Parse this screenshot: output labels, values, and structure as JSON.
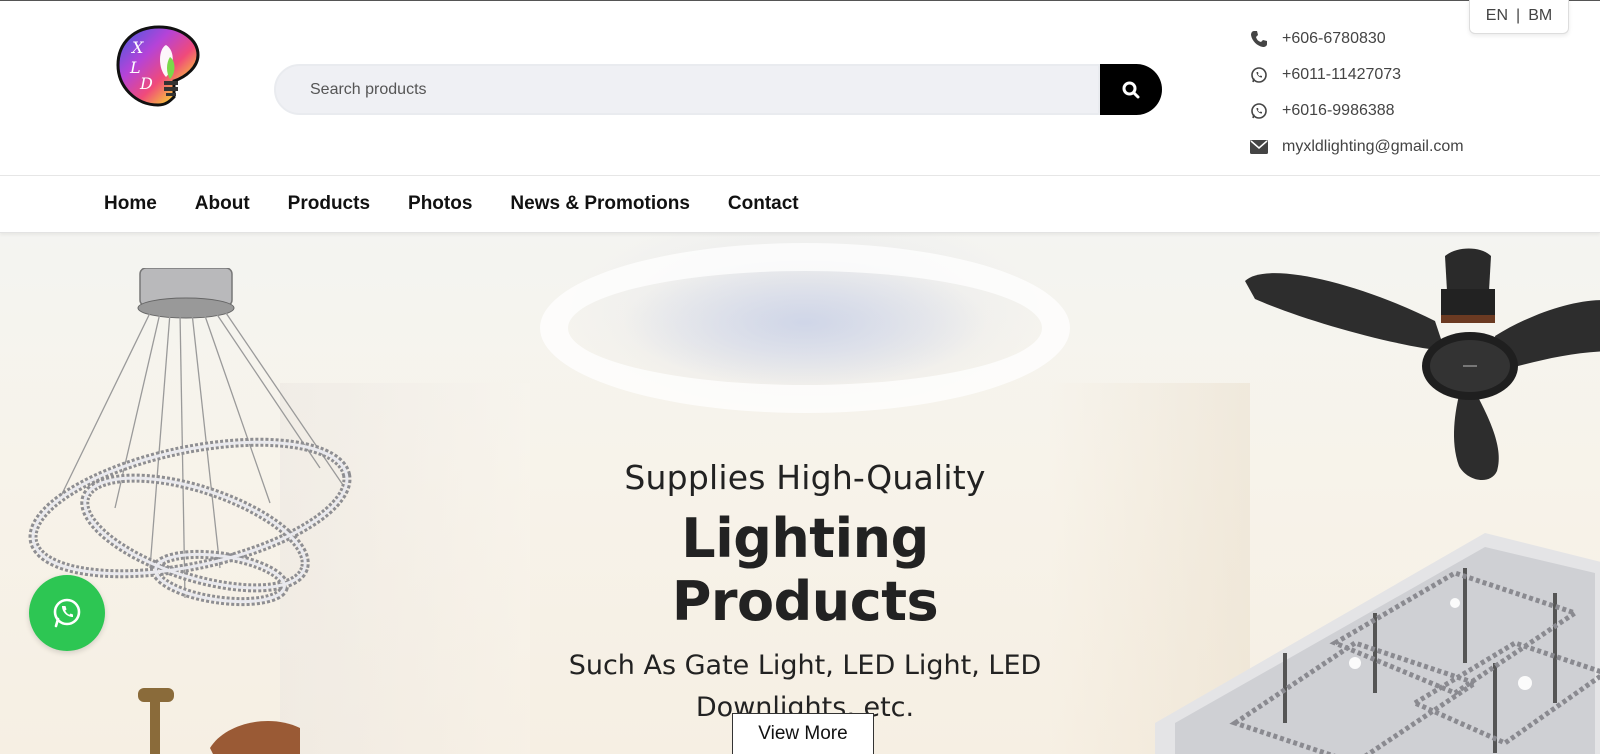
{
  "header": {
    "search": {
      "placeholder": "Search products"
    },
    "contacts": [
      {
        "icon": "phone-icon",
        "text": "+606-6780830"
      },
      {
        "icon": "whatsapp-icon",
        "text": "+6011-11427073"
      },
      {
        "icon": "whatsapp-icon",
        "text": "+6016-9986388"
      },
      {
        "icon": "envelope-icon",
        "text": "myxldlighting@gmail.com"
      }
    ],
    "language": {
      "en": "EN",
      "separator": "|",
      "bm": "BM"
    }
  },
  "nav": {
    "items": [
      {
        "label": "Home"
      },
      {
        "label": "About"
      },
      {
        "label": "Products"
      },
      {
        "label": "Photos"
      },
      {
        "label": "News & Promotions"
      },
      {
        "label": "Contact"
      }
    ]
  },
  "hero": {
    "subtitle": "Supplies High-Quality",
    "title": "Lighting Products",
    "description": "Such As Gate Light, LED Light, LED Downlights, etc.",
    "button": "View More"
  },
  "colors": {
    "whatsapp_green": "#2dc653",
    "search_button": "#000000",
    "search_bg": "#eff0f4"
  }
}
